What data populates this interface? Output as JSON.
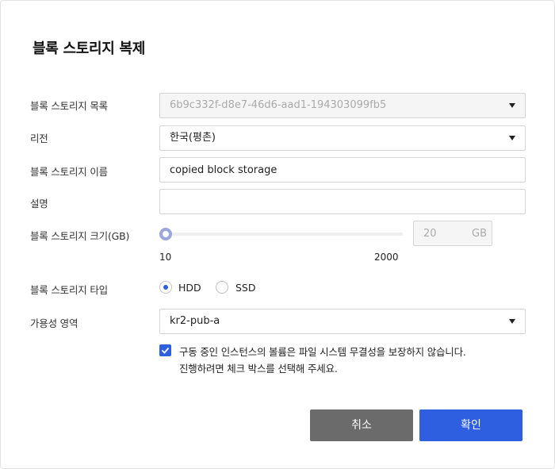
{
  "dialog": {
    "title": "블록 스토리지 복제"
  },
  "form": {
    "source": {
      "label": "블록 스토리지 목록",
      "value": "6b9c332f-d8e7-46d6-aad1-194303099fb5"
    },
    "region": {
      "label": "리전",
      "value": "한국(평촌)"
    },
    "name": {
      "label": "블록 스토리지 이름",
      "value": "copied block storage"
    },
    "description": {
      "label": "설명",
      "value": ""
    },
    "size": {
      "label": "블록 스토리지 크기(GB)",
      "min": "10",
      "max": "2000",
      "value": "20",
      "unit": "GB",
      "slider_fraction": 0
    },
    "type": {
      "label": "블록 스토리지 타입",
      "options": [
        {
          "label": "HDD",
          "selected": true
        },
        {
          "label": "SSD",
          "selected": false
        }
      ]
    },
    "zone": {
      "label": "가용성 영역",
      "value": "kr2-pub-a"
    },
    "confirm": {
      "checked": true,
      "line1": "구동 중인 인스턴스의 볼륨은 파일 시스템 무결성을 보장하지 않습니다.",
      "line2": "진행하려면 체크 박스를 선택해 주세요."
    }
  },
  "buttons": {
    "cancel": "취소",
    "ok": "확인"
  },
  "colors": {
    "primary": "#2d5fe0",
    "cancel": "#6b6b6b"
  }
}
